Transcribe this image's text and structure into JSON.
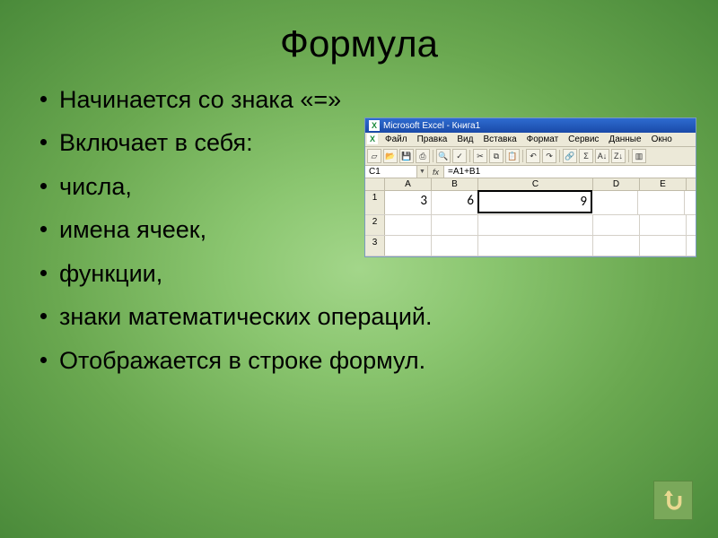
{
  "title": "Формула",
  "bullets": [
    "Начинается со знака  «=»",
    "Включает в себя:",
    "числа,",
    "имена ячеек,",
    "функции,",
    "знаки математических операций.",
    "Отображается в строке формул."
  ],
  "excel": {
    "window_title": "Microsoft Excel - Книга1",
    "menu": [
      "Файл",
      "Правка",
      "Вид",
      "Вставка",
      "Формат",
      "Сервис",
      "Данные",
      "Окно"
    ],
    "name_box": "C1",
    "fx_label": "fx",
    "formula": "=A1+B1",
    "columns": [
      "A",
      "B",
      "C",
      "D",
      "E"
    ],
    "rows": [
      {
        "n": "1",
        "cells": [
          "3",
          "6",
          "9",
          "",
          ""
        ]
      },
      {
        "n": "2",
        "cells": [
          "",
          "",
          "",
          "",
          ""
        ]
      },
      {
        "n": "3",
        "cells": [
          "",
          "",
          "",
          "",
          ""
        ]
      }
    ],
    "selected": {
      "row": 0,
      "col": 2
    }
  },
  "nav": {
    "return_label": "return"
  }
}
